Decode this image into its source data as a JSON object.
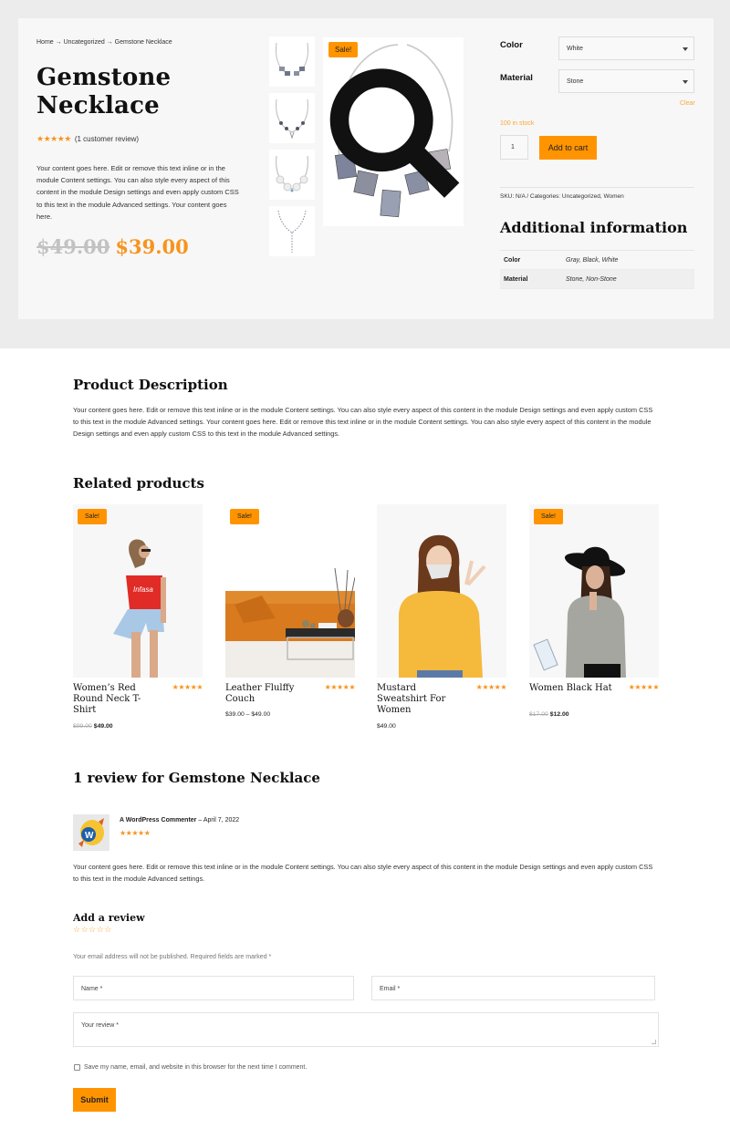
{
  "breadcrumb": {
    "items": [
      "Home",
      "Uncategorized",
      "Gemstone Necklace"
    ],
    "separator": "→",
    "text": "Home → Uncategorized → Gemstone Necklace"
  },
  "product": {
    "title_line1": "Gemstone",
    "title_line2": "Necklace",
    "rating_stars": "★★★★★",
    "rating_value": 5,
    "review_link": "(1 customer review)",
    "short_description": "Your content goes here. Edit or remove this text inline or in the module Content settings. You can also style every aspect of this content in the module Design settings and even apply custom CSS to this text in the module Advanced settings. Your content goes here.",
    "price_old": "$49.00",
    "price_new": "$39.00",
    "sale_badge": "Sale!",
    "gallery_thumbs": [
      "necklace-thumb-1",
      "necklace-thumb-2",
      "necklace-thumb-3",
      "necklace-thumb-4"
    ],
    "zoom_icon": "magnifier-icon"
  },
  "variations": {
    "color_label": "Color",
    "color_value": "White",
    "material_label": "Material",
    "material_value": "Stone",
    "clear_label": "Clear"
  },
  "stock": "100 in stock",
  "quantity": "1",
  "add_to_cart": "Add to cart",
  "meta": "SKU: N/A / Categories: Uncategorized, Women",
  "additional_info": {
    "title": "Additional information",
    "rows": [
      {
        "key": "Color",
        "value": "Gray, Black, White"
      },
      {
        "key": "Material",
        "value": "Stone, Non-Stone"
      }
    ]
  },
  "description": {
    "title": "Product Description",
    "text": "Your content goes here. Edit or remove this text inline or in the module Content settings. You can also style every aspect of this content in the module Design settings and even apply custom CSS to this text in the module Advanced settings. Your content goes here. Edit or remove this text inline or in the module Content settings. You can also style every aspect of this content in the module Design settings and even apply custom CSS to this text in the module Advanced settings."
  },
  "related": {
    "title": "Related products",
    "products": [
      {
        "name": "Women’s Red Round Neck T-Shirt",
        "sale": "Sale!",
        "stars": "★★★★★",
        "price_old": "$99.00",
        "price": "$49.00"
      },
      {
        "name": "Leather Flulffy Couch",
        "sale": "Sale!",
        "stars": "★★★★★",
        "price_old": "",
        "price": "$39.00 – $49.00"
      },
      {
        "name": "Mustard Sweatshirt For Women",
        "sale": "",
        "stars": "★★★★★",
        "price_old": "",
        "price": "$49.00"
      },
      {
        "name": "Women Black Hat",
        "sale": "Sale!",
        "stars": "★★★★★",
        "price_old": "$17.00",
        "price": "$12.00"
      }
    ]
  },
  "reviews": {
    "title": "1 review for Gemstone Necklace",
    "items": [
      {
        "author": "A WordPress Commenter",
        "date": "April 7, 2022",
        "dash": "–",
        "stars": "★★★★★",
        "text": "Your content goes here. Edit or remove this text inline or in the module Content settings. You can also style every aspect of this content in the module Design settings and even apply custom CSS to this text in the module Advanced settings."
      }
    ]
  },
  "review_form": {
    "title": "Add a review",
    "empty_stars": "☆☆☆☆☆",
    "notes": "Your email address will not be published. Required fields are marked *",
    "name_placeholder": "Name *",
    "email_placeholder": "Email *",
    "review_placeholder": "Your review *",
    "consent": "Save my name, email, and website in this browser for the next time I comment.",
    "submit": "Submit"
  },
  "colors": {
    "accent": "#ff9400",
    "star": "#f7941d",
    "band": "#ececec",
    "panel": "#f7f7f7"
  }
}
